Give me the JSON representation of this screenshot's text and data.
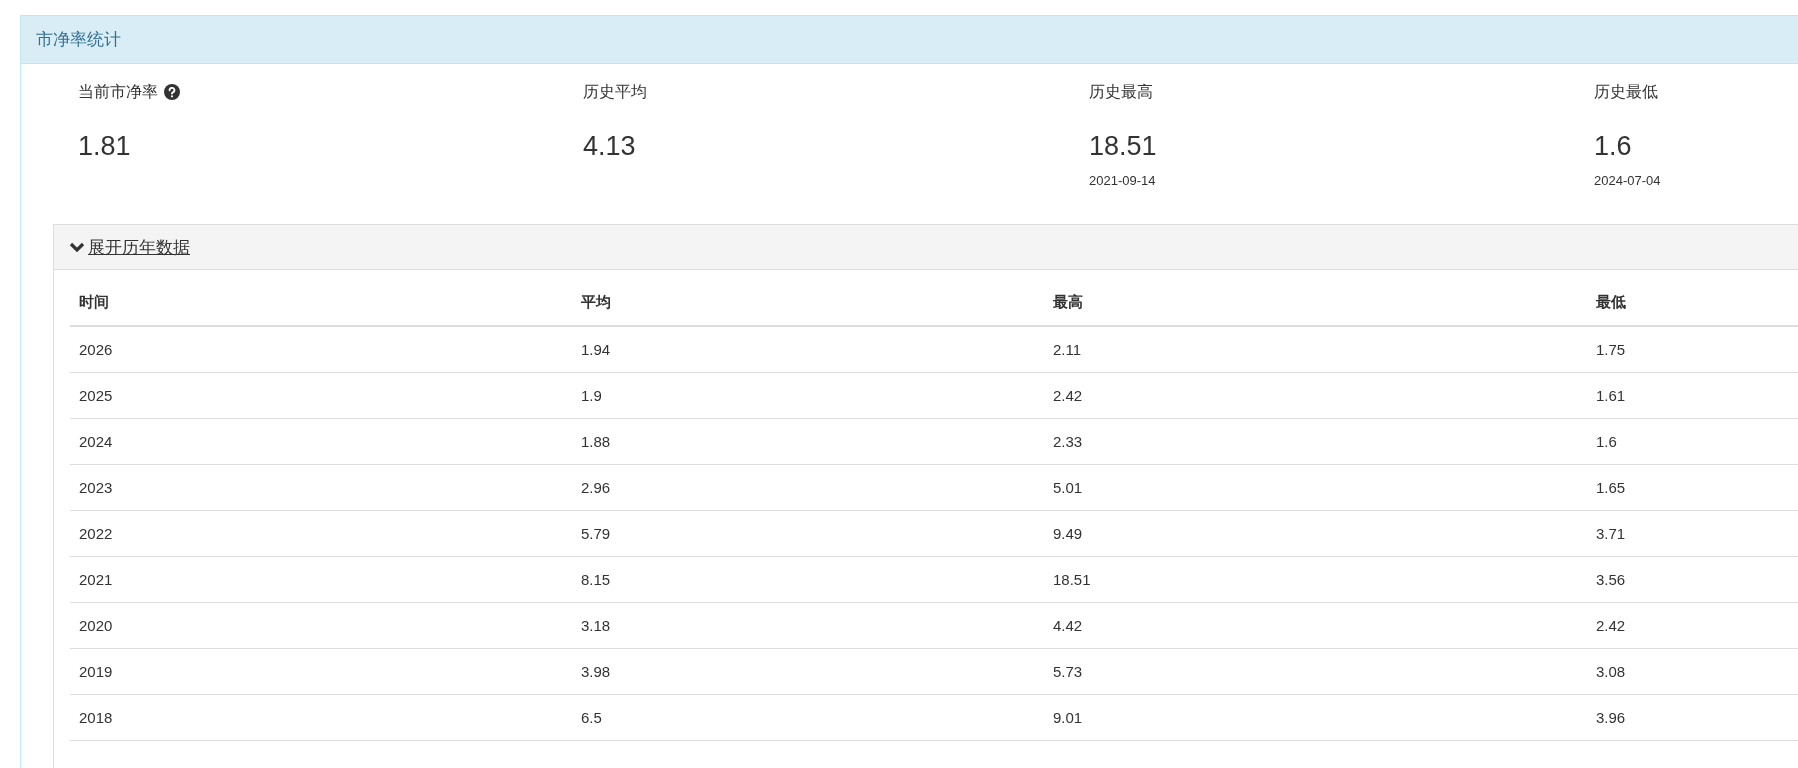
{
  "panel": {
    "title": "市净率统计"
  },
  "stats": [
    {
      "label": "当前市净率",
      "help": true,
      "value": "1.81"
    },
    {
      "label": "历史平均",
      "help": false,
      "value": "4.13"
    },
    {
      "label": "历史最高",
      "help": false,
      "value": "18.51",
      "date": "2021-09-14"
    },
    {
      "label": "历史最低",
      "help": false,
      "value": "1.6",
      "date": "2024-07-04"
    }
  ],
  "history": {
    "toggle": "展开历年数据",
    "expanded": true,
    "columns": [
      "时间",
      "平均",
      "最高",
      "最低"
    ],
    "rows": [
      [
        "2026",
        "1.94",
        "2.11",
        "1.75"
      ],
      [
        "2025",
        "1.9",
        "2.42",
        "1.61"
      ],
      [
        "2024",
        "1.88",
        "2.33",
        "1.6"
      ],
      [
        "2023",
        "2.96",
        "5.01",
        "1.65"
      ],
      [
        "2022",
        "5.79",
        "9.49",
        "3.71"
      ],
      [
        "2021",
        "8.15",
        "18.51",
        "3.56"
      ],
      [
        "2020",
        "3.18",
        "4.42",
        "2.42"
      ],
      [
        "2019",
        "3.98",
        "5.73",
        "3.08"
      ],
      [
        "2018",
        "6.5",
        "9.01",
        "3.96"
      ]
    ]
  }
}
